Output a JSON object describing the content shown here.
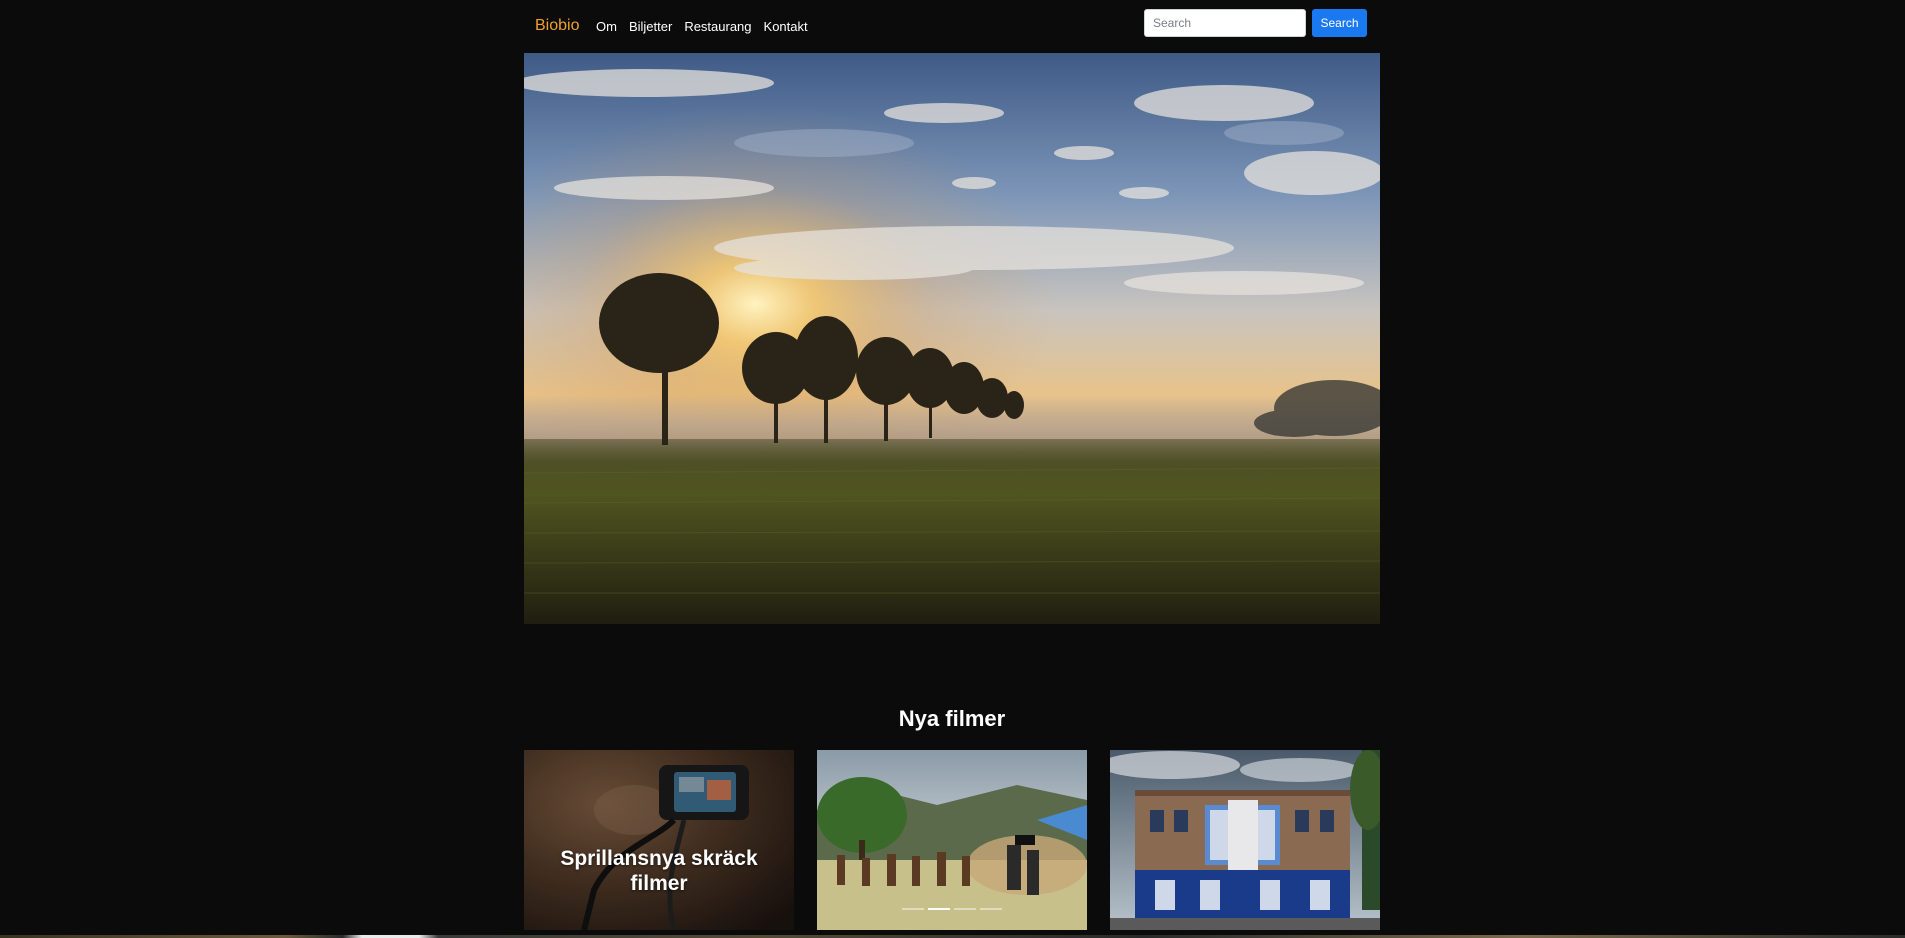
{
  "navbar": {
    "brand": "Biobio",
    "links": [
      "Om",
      "Biljetter",
      "Restaurang",
      "Kontakt"
    ],
    "search": {
      "placeholder": "Search",
      "value": "",
      "button_label": "Search"
    }
  },
  "hero": {
    "image": "landscape-sunrise-trees-field"
  },
  "new_films": {
    "title": "Nya filmer",
    "cards": [
      {
        "image": "camera-rig-monitor",
        "caption": "Sprillansnya skräck filmer"
      },
      {
        "image": "film-crew-on-location",
        "caption": "",
        "indicators": 4,
        "active_indicator": 2
      },
      {
        "image": "historic-movie-theater-facade",
        "caption": ""
      }
    ]
  },
  "colors": {
    "background": "#0b0b0b",
    "brand": "#f0a030",
    "accent": "#1a78f0",
    "text": "#ffffff"
  }
}
